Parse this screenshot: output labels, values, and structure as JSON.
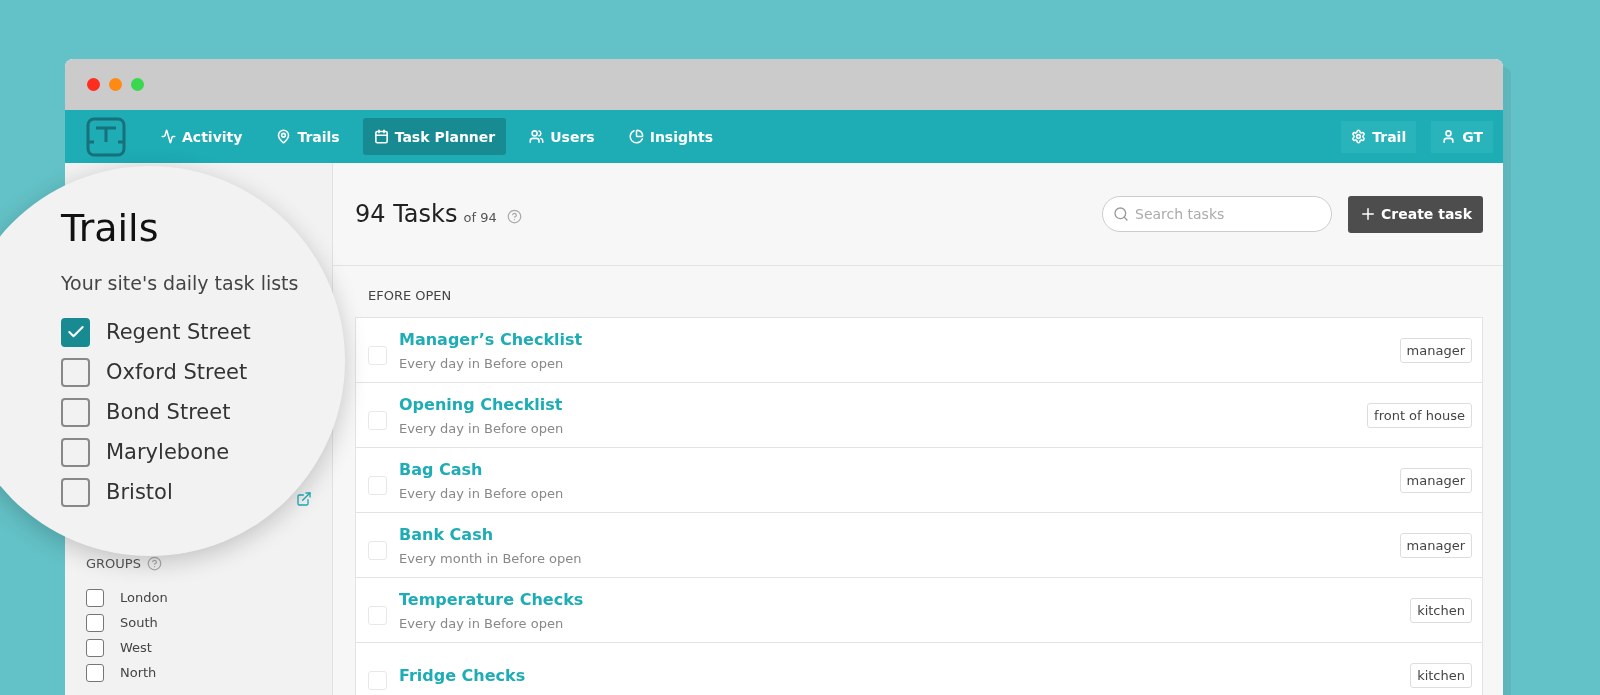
{
  "nav": {
    "items": [
      {
        "label": "Activity",
        "selected": false
      },
      {
        "label": "Trails",
        "selected": false
      },
      {
        "label": "Task Planner",
        "selected": true
      },
      {
        "label": "Users",
        "selected": false
      },
      {
        "label": "Insights",
        "selected": false
      }
    ],
    "right": [
      {
        "label": "Trail"
      },
      {
        "label": "GT"
      }
    ]
  },
  "magnifier": {
    "title": "Trails",
    "subtitle": "Your site's daily task lists",
    "sites": [
      {
        "name": "Regent Street",
        "checked": true
      },
      {
        "name": "Oxford Street",
        "checked": false
      },
      {
        "name": "Bond Street",
        "checked": false
      },
      {
        "name": "Marylebone",
        "checked": false
      },
      {
        "name": "Bristol",
        "checked": false
      }
    ]
  },
  "sidebar": {
    "groups_label": "GROUPS",
    "groups": [
      {
        "name": "London",
        "checked": false
      },
      {
        "name": "South",
        "checked": false
      },
      {
        "name": "West",
        "checked": false
      },
      {
        "name": "North",
        "checked": false
      }
    ]
  },
  "header": {
    "count": "94 Tasks",
    "of": "of 94",
    "search_placeholder": "Search tasks",
    "create_label": "Create task"
  },
  "section_label": "EFORE OPEN",
  "tasks": [
    {
      "title": "Manager’s Checklist",
      "schedule": "Every day in Before open",
      "tag": "manager",
      "checked": false
    },
    {
      "title": "Opening Checklist",
      "schedule": "Every day in Before open",
      "tag": "front of house",
      "checked": false
    },
    {
      "title": "Bag Cash",
      "schedule": "Every day in Before open",
      "tag": "manager",
      "checked": false
    },
    {
      "title": "Bank Cash",
      "schedule": "Every month in Before open",
      "tag": "manager",
      "checked": false
    },
    {
      "title": "Temperature Checks",
      "schedule": "Every day in Before open",
      "tag": "kitchen",
      "checked": false
    },
    {
      "title": "Fridge Checks",
      "tag": "kitchen",
      "checked": false
    }
  ]
}
